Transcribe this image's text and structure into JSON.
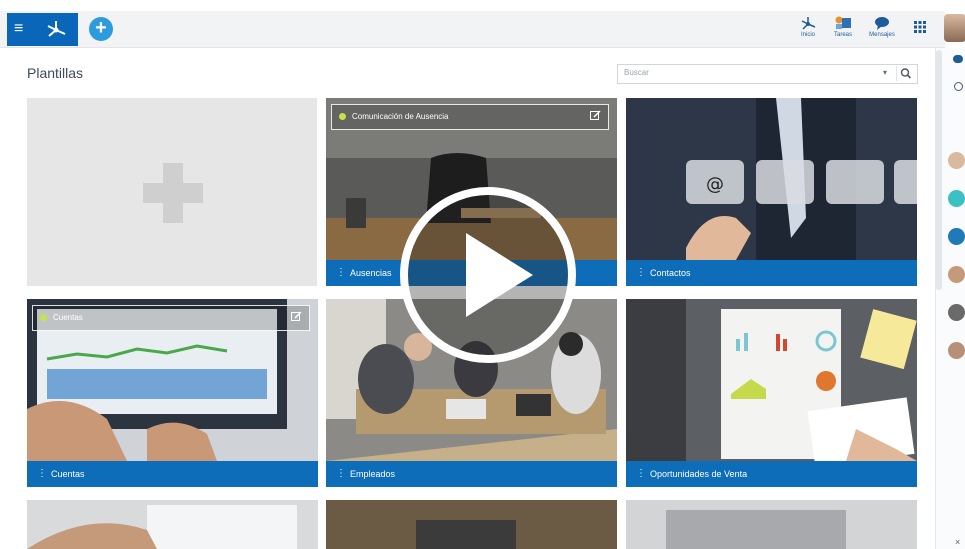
{
  "header": {
    "nav": [
      {
        "label": "Inicio",
        "icon": "home-network-icon"
      },
      {
        "label": "Tareas",
        "icon": "tasks-icon"
      },
      {
        "label": "Mensajes",
        "icon": "messages-icon"
      }
    ]
  },
  "page": {
    "title": "Plantillas"
  },
  "search": {
    "placeholder": "Buscar"
  },
  "cards": [
    {
      "label": "Ausencias",
      "tag": "Comunicación de Ausencia"
    },
    {
      "label": "Contactos"
    },
    {
      "label": "Cuentas",
      "tag": "Cuentas"
    },
    {
      "label": "Empleados"
    },
    {
      "label": "Oportunidades de Venta"
    }
  ],
  "colors": {
    "brand": "#0a66b8",
    "card_bar": "#0d6db8",
    "accent": "#2f9bdf",
    "status_dot": "#c7e34a"
  }
}
